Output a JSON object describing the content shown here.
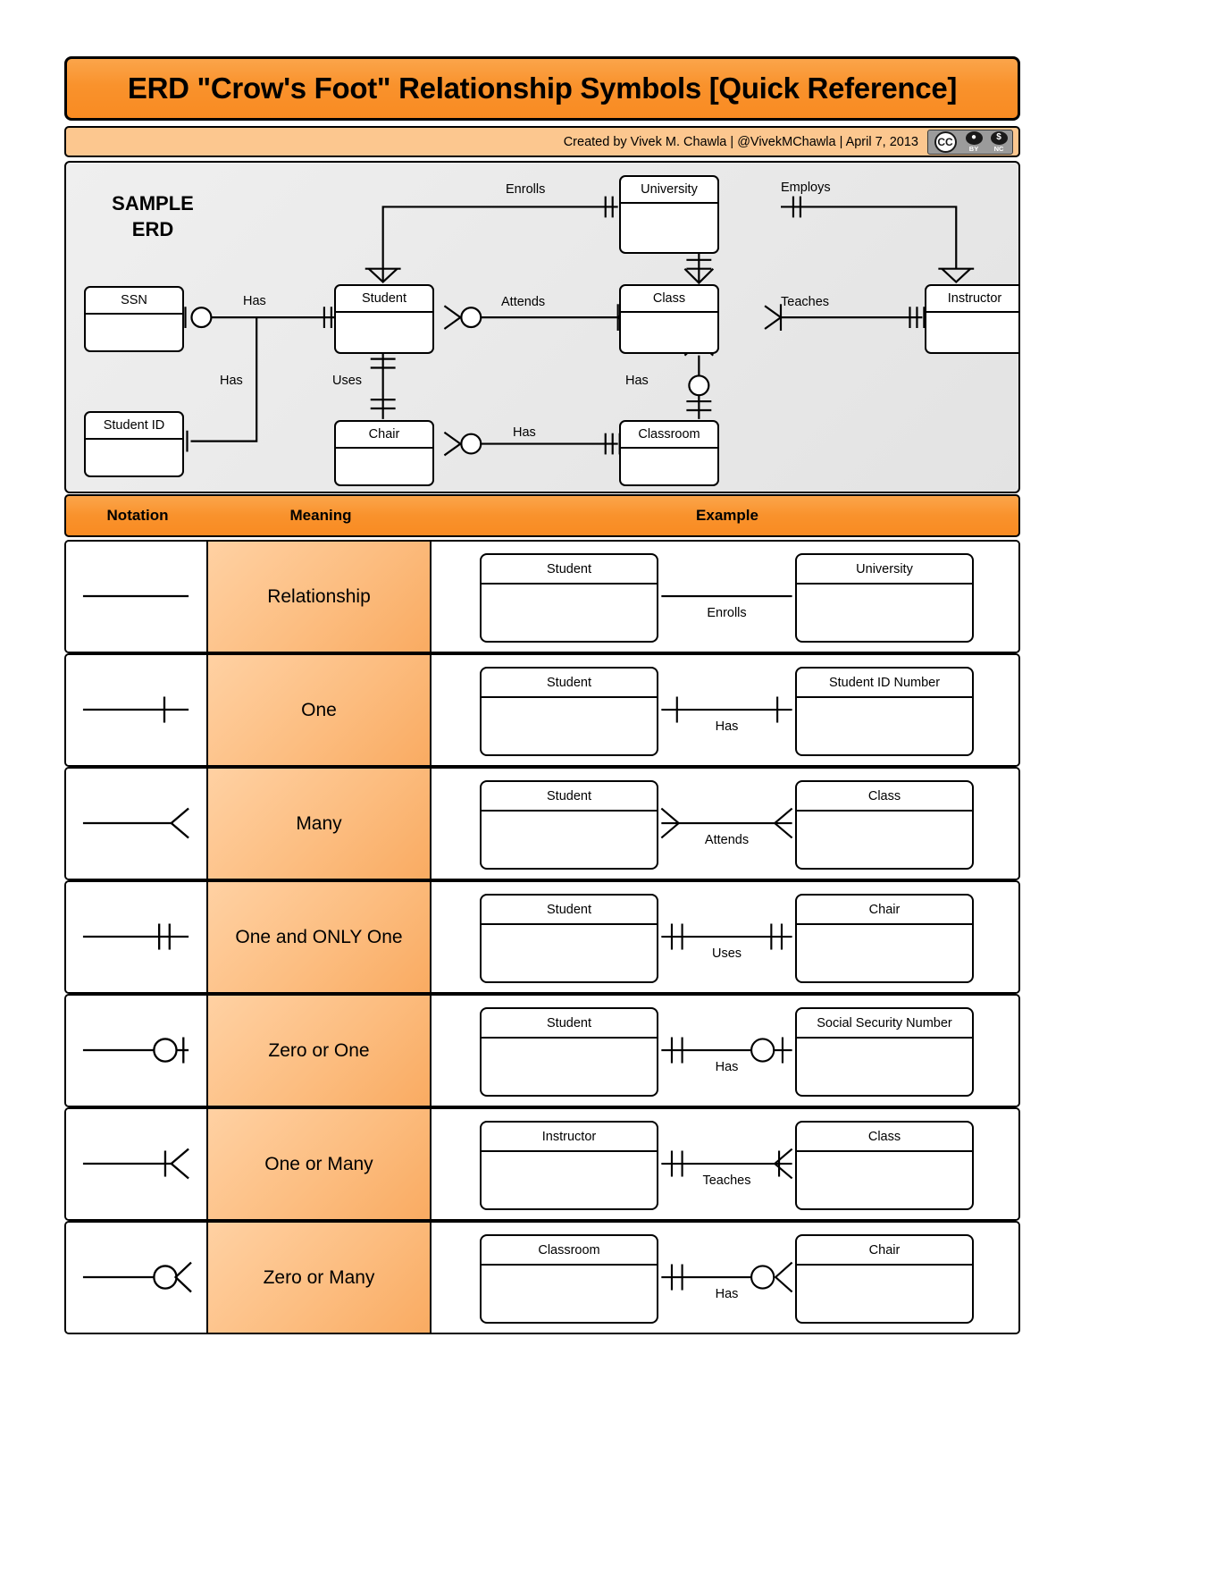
{
  "header": {
    "title": "ERD \"Crow's Foot\" Relationship Symbols [Quick Reference]",
    "byline": "Created by Vivek M. Chawla |  @VivekMChawla  |  April 7, 2013",
    "license": {
      "cc_label": "CC",
      "by_label": "BY",
      "nc_label": "NC",
      "by_glyph": "i",
      "nc_glyph": "$"
    }
  },
  "sample_erd": {
    "panel_label_line1": "SAMPLE",
    "panel_label_line2": "ERD",
    "entities": [
      {
        "name": "SSN"
      },
      {
        "name": "Student ID"
      },
      {
        "name": "Student"
      },
      {
        "name": "Chair"
      },
      {
        "name": "University"
      },
      {
        "name": "Class"
      },
      {
        "name": "Classroom"
      },
      {
        "name": "Instructor"
      }
    ],
    "relationship_labels": [
      {
        "text": "Enrolls"
      },
      {
        "text": "Employs"
      },
      {
        "text": "Has"
      },
      {
        "text": "Attends"
      },
      {
        "text": "Teaches"
      },
      {
        "text": "Has"
      },
      {
        "text": "Uses"
      },
      {
        "text": "Has"
      },
      {
        "text": "Has"
      }
    ]
  },
  "table": {
    "columns": {
      "notation": "Notation",
      "meaning": "Meaning",
      "example": "Example"
    },
    "rows": [
      {
        "meaning": "Relationship",
        "notation_symbol": "plain-line",
        "example": {
          "left_entity": "Student",
          "right_entity": "University",
          "label": "Enrolls",
          "left_marker": "none",
          "right_marker": "none"
        }
      },
      {
        "meaning": "One",
        "notation_symbol": "one-tick",
        "example": {
          "left_entity": "Student",
          "right_entity": "Student ID Number",
          "label": "Has",
          "left_marker": "one",
          "right_marker": "one"
        }
      },
      {
        "meaning": "Many",
        "notation_symbol": "crows-foot",
        "example": {
          "left_entity": "Student",
          "right_entity": "Class",
          "label": "Attends",
          "left_marker": "many",
          "right_marker": "many"
        }
      },
      {
        "meaning": "One and ONLY One",
        "notation_symbol": "double-tick",
        "example": {
          "left_entity": "Student",
          "right_entity": "Chair",
          "label": "Uses",
          "left_marker": "one-only-one",
          "right_marker": "one-only-one"
        }
      },
      {
        "meaning": "Zero or One",
        "notation_symbol": "circle-tick",
        "example": {
          "left_entity": "Student",
          "right_entity": "Social Security Number",
          "label": "Has",
          "left_marker": "one-only-one",
          "right_marker": "zero-or-one"
        }
      },
      {
        "meaning": "One or Many",
        "notation_symbol": "tick-crows-foot",
        "example": {
          "left_entity": "Instructor",
          "right_entity": "Class",
          "label": "Teaches",
          "left_marker": "one-only-one",
          "right_marker": "one-or-many"
        }
      },
      {
        "meaning": "Zero or Many",
        "notation_symbol": "circle-crows-foot",
        "example": {
          "left_entity": "Classroom",
          "right_entity": "Chair",
          "label": "Has",
          "left_marker": "one-only-one",
          "right_marker": "zero-or-many"
        }
      }
    ]
  },
  "colors": {
    "orange_header": "#f98b22",
    "orange_light": "#fcc78f",
    "meaning_fill": "#fcbd80",
    "panel_gray": "#e9e9e9"
  }
}
